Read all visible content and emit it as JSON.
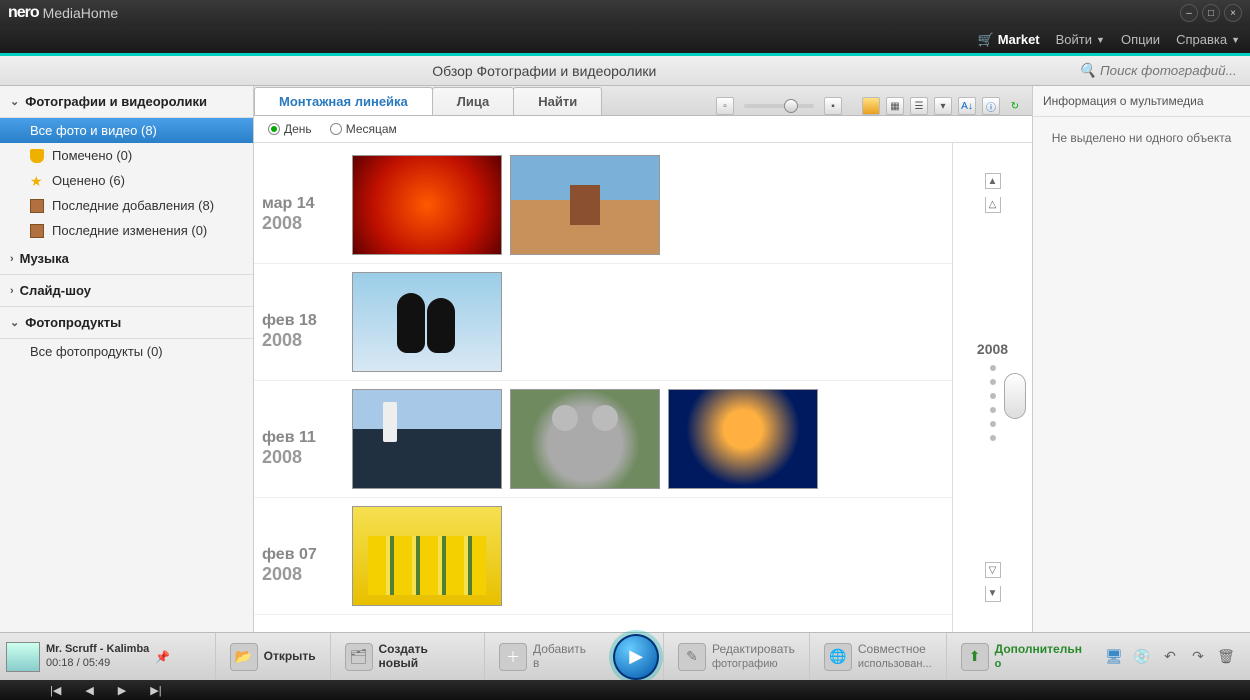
{
  "app": {
    "brand": "nero",
    "name": "MediaHome"
  },
  "menu": {
    "market": "Market",
    "login": "Войти",
    "options": "Опции",
    "help": "Справка"
  },
  "subheader": {
    "title": "Обзор Фотографии и видеоролики",
    "search_placeholder": "Поиск фотографий..."
  },
  "sidebar": {
    "sections": [
      {
        "label": "Фотографии и видеоролики",
        "expanded": true,
        "items": [
          {
            "label": "Все фото и видео (8)",
            "icon": "none",
            "selected": true
          },
          {
            "label": "Помечено (0)",
            "icon": "tag"
          },
          {
            "label": "Оценено (6)",
            "icon": "star"
          },
          {
            "label": "Последние добавления (8)",
            "icon": "img"
          },
          {
            "label": "Последние изменения (0)",
            "icon": "img"
          }
        ]
      },
      {
        "label": "Музыка",
        "expanded": false,
        "items": []
      },
      {
        "label": "Слайд-шоу",
        "expanded": false,
        "items": []
      },
      {
        "label": "Фотопродукты",
        "expanded": true,
        "items": [
          {
            "label": "Все фотопродукты (0)",
            "icon": "none"
          }
        ]
      }
    ]
  },
  "tabs": {
    "t1": "Монтажная линейка",
    "t2": "Лица",
    "t3": "Найти"
  },
  "viewopts": {
    "day": "День",
    "month": "Месяцам"
  },
  "dates": [
    {
      "day": "мар 14",
      "year": "2008",
      "thumbs": [
        "flower",
        "desert"
      ]
    },
    {
      "day": "фев 18",
      "year": "2008",
      "thumbs": [
        "penguin"
      ]
    },
    {
      "day": "фев 11",
      "year": "2008",
      "thumbs": [
        "light",
        "koala",
        "jelly"
      ]
    },
    {
      "day": "фев 07",
      "year": "2008",
      "thumbs": [
        "tulip"
      ]
    }
  ],
  "timeline": {
    "year": "2008"
  },
  "infopanel": {
    "title": "Информация о мультимедиа",
    "body": "Не выделено ни одного объекта"
  },
  "bottom": {
    "track": "Mr. Scruff - Kalimba",
    "time": "00:18 / 05:49",
    "open": "Открыть",
    "createnew": "Создать новый",
    "addto": "Добавить в",
    "edit1": "Редактировать",
    "edit2": "фотографию",
    "share1": "Совместное",
    "share2": "использован...",
    "more1": "Дополнительн",
    "more2": "о"
  }
}
